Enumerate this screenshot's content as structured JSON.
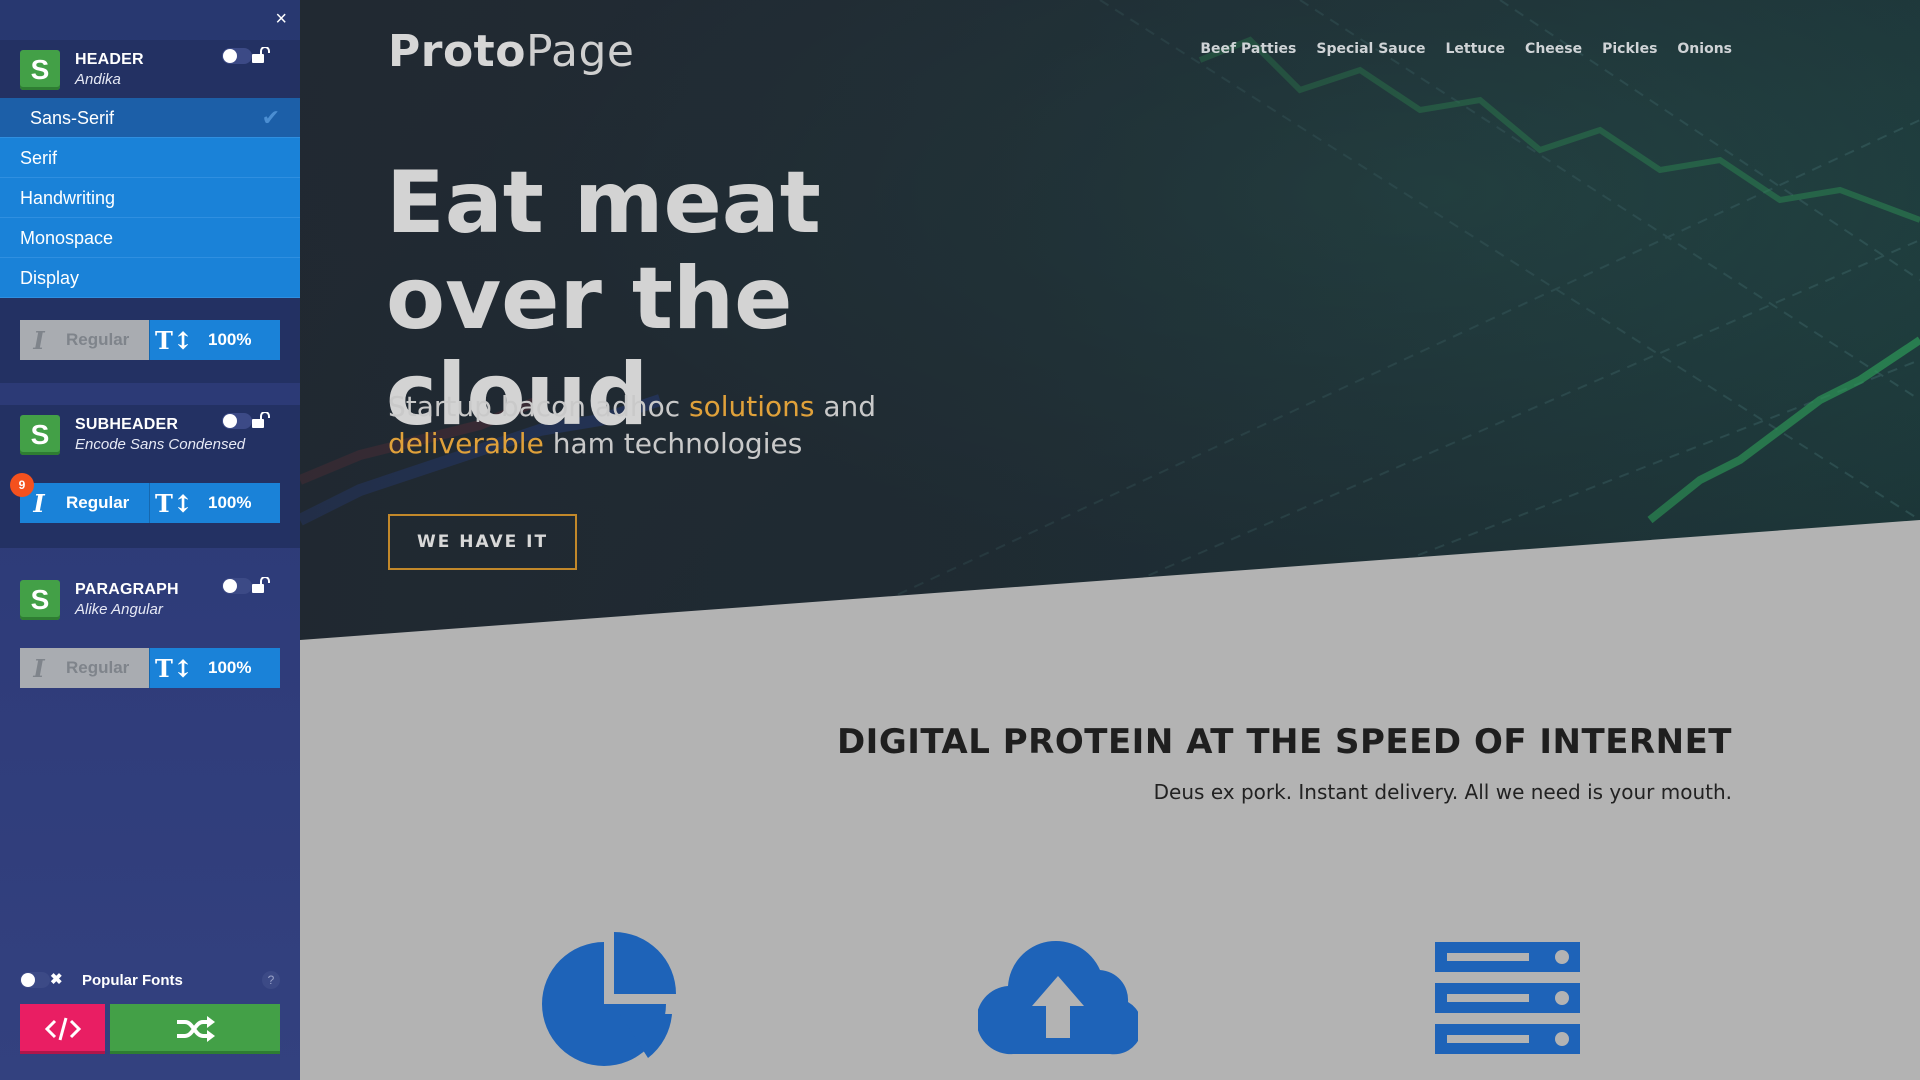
{
  "sidebar": {
    "close_label": "×",
    "blocks": [
      {
        "title": "HEADER",
        "font": "Andika",
        "badge": "S",
        "weight": "Regular",
        "size": "100%",
        "weight_active": false,
        "enabled": false
      },
      {
        "title": "SUBHEADER",
        "font": "Encode Sans Condensed",
        "badge": "S",
        "weight": "Regular",
        "size": "100%",
        "weight_active": true,
        "enabled": false,
        "notification_count": "9"
      },
      {
        "title": "PARAGRAPH",
        "font": "Alike Angular",
        "badge": "S",
        "weight": "Regular",
        "size": "100%",
        "weight_active": false,
        "enabled": false
      }
    ],
    "font_categories": [
      {
        "label": "Sans-Serif",
        "selected": true
      },
      {
        "label": "Serif",
        "selected": false
      },
      {
        "label": "Handwriting",
        "selected": false
      },
      {
        "label": "Monospace",
        "selected": false
      },
      {
        "label": "Display",
        "selected": false
      }
    ],
    "check_glyph": "✔",
    "italic_glyph": "I",
    "size_glyph": "T↕",
    "popular": {
      "label": "Popular Fonts",
      "enabled": false,
      "x": "✖",
      "help": "?"
    }
  },
  "page": {
    "logo_bold": "Proto",
    "logo_light": "Page",
    "nav": [
      "Beef Patties",
      "Special Sauce",
      "Lettuce",
      "Cheese",
      "Pickles",
      "Onions"
    ],
    "headline": "Eat meat over the cloud",
    "sub_parts": [
      "Startup bacon adhoc ",
      "solutions",
      " and ",
      "deliverable",
      " ham technologies"
    ],
    "cta": "WE HAVE IT",
    "section_title": "DIGITAL PROTEIN AT THE SPEED OF INTERNET",
    "section_sub": "Deus ex pork. Instant delivery. All we need is your mouth.",
    "features": [
      "pie-chart-icon",
      "cloud-upload-icon",
      "server-icon"
    ]
  },
  "colors": {
    "sidebar_bg": "#2f3c7a",
    "accent_blue": "#1a82d8",
    "badge_green": "#43a047",
    "code_pink": "#e91e63",
    "accent_orange": "#e0a13a",
    "feature_blue": "#1e63b8"
  }
}
